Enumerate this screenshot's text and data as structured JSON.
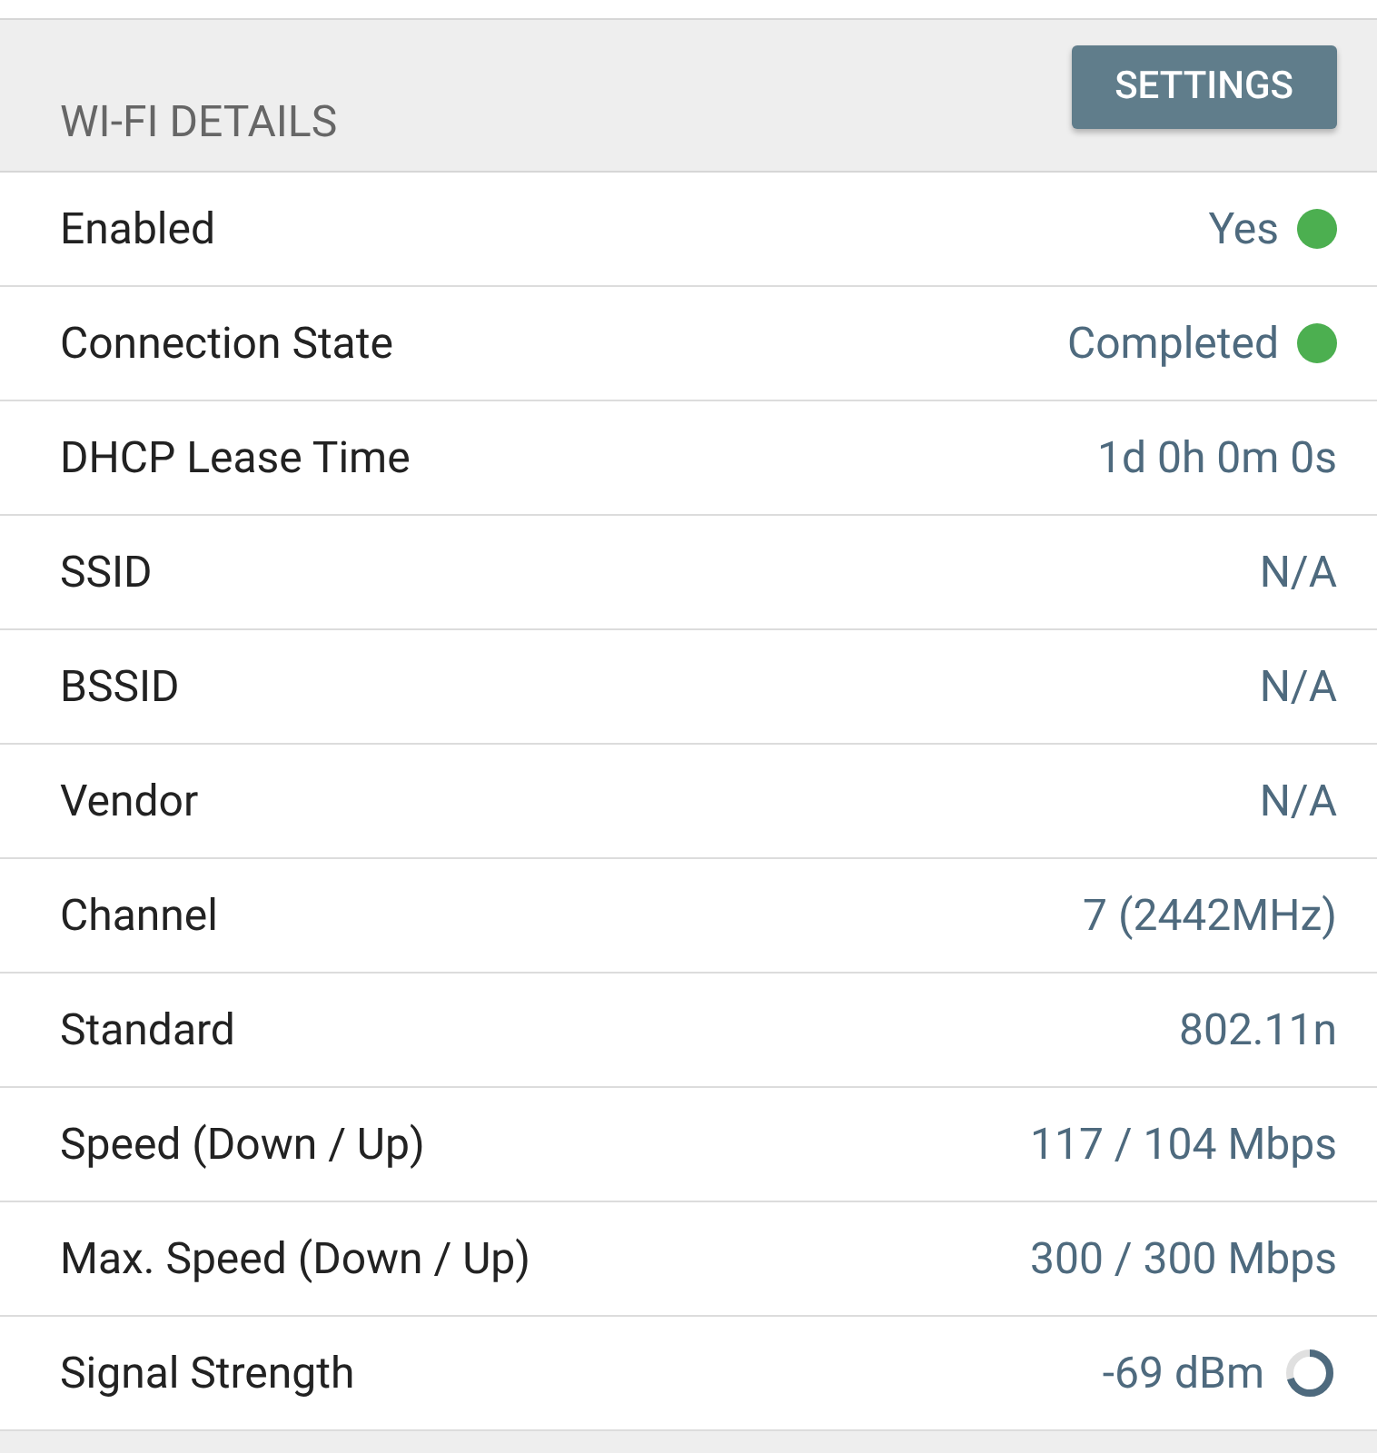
{
  "panel": {
    "title": "WI-FI DETAILS",
    "button": "SETTINGS"
  },
  "rows": [
    {
      "label": "Enabled",
      "value": "Yes",
      "kind": "dot",
      "color": "#4caf50"
    },
    {
      "label": "Connection State",
      "value": "Completed",
      "kind": "dot",
      "color": "#4caf50"
    },
    {
      "label": "DHCP Lease Time",
      "value": "1d 0h 0m 0s",
      "kind": "plain"
    },
    {
      "label": "SSID",
      "value": "N/A",
      "kind": "plain"
    },
    {
      "label": "BSSID",
      "value": "N/A",
      "kind": "plain"
    },
    {
      "label": "Vendor",
      "value": "N/A",
      "kind": "plain"
    },
    {
      "label": "Channel",
      "value": "7 (2442MHz)",
      "kind": "plain"
    },
    {
      "label": "Standard",
      "value": "802.11n",
      "kind": "plain"
    },
    {
      "label": "Speed (Down / Up)",
      "value": "117 / 104 Mbps",
      "kind": "plain"
    },
    {
      "label": "Max. Speed (Down / Up)",
      "value": "300 / 300 Mbps",
      "kind": "plain"
    },
    {
      "label": "Signal Strength",
      "value": "-69 dBm",
      "kind": "ring",
      "level": 0.7
    }
  ]
}
